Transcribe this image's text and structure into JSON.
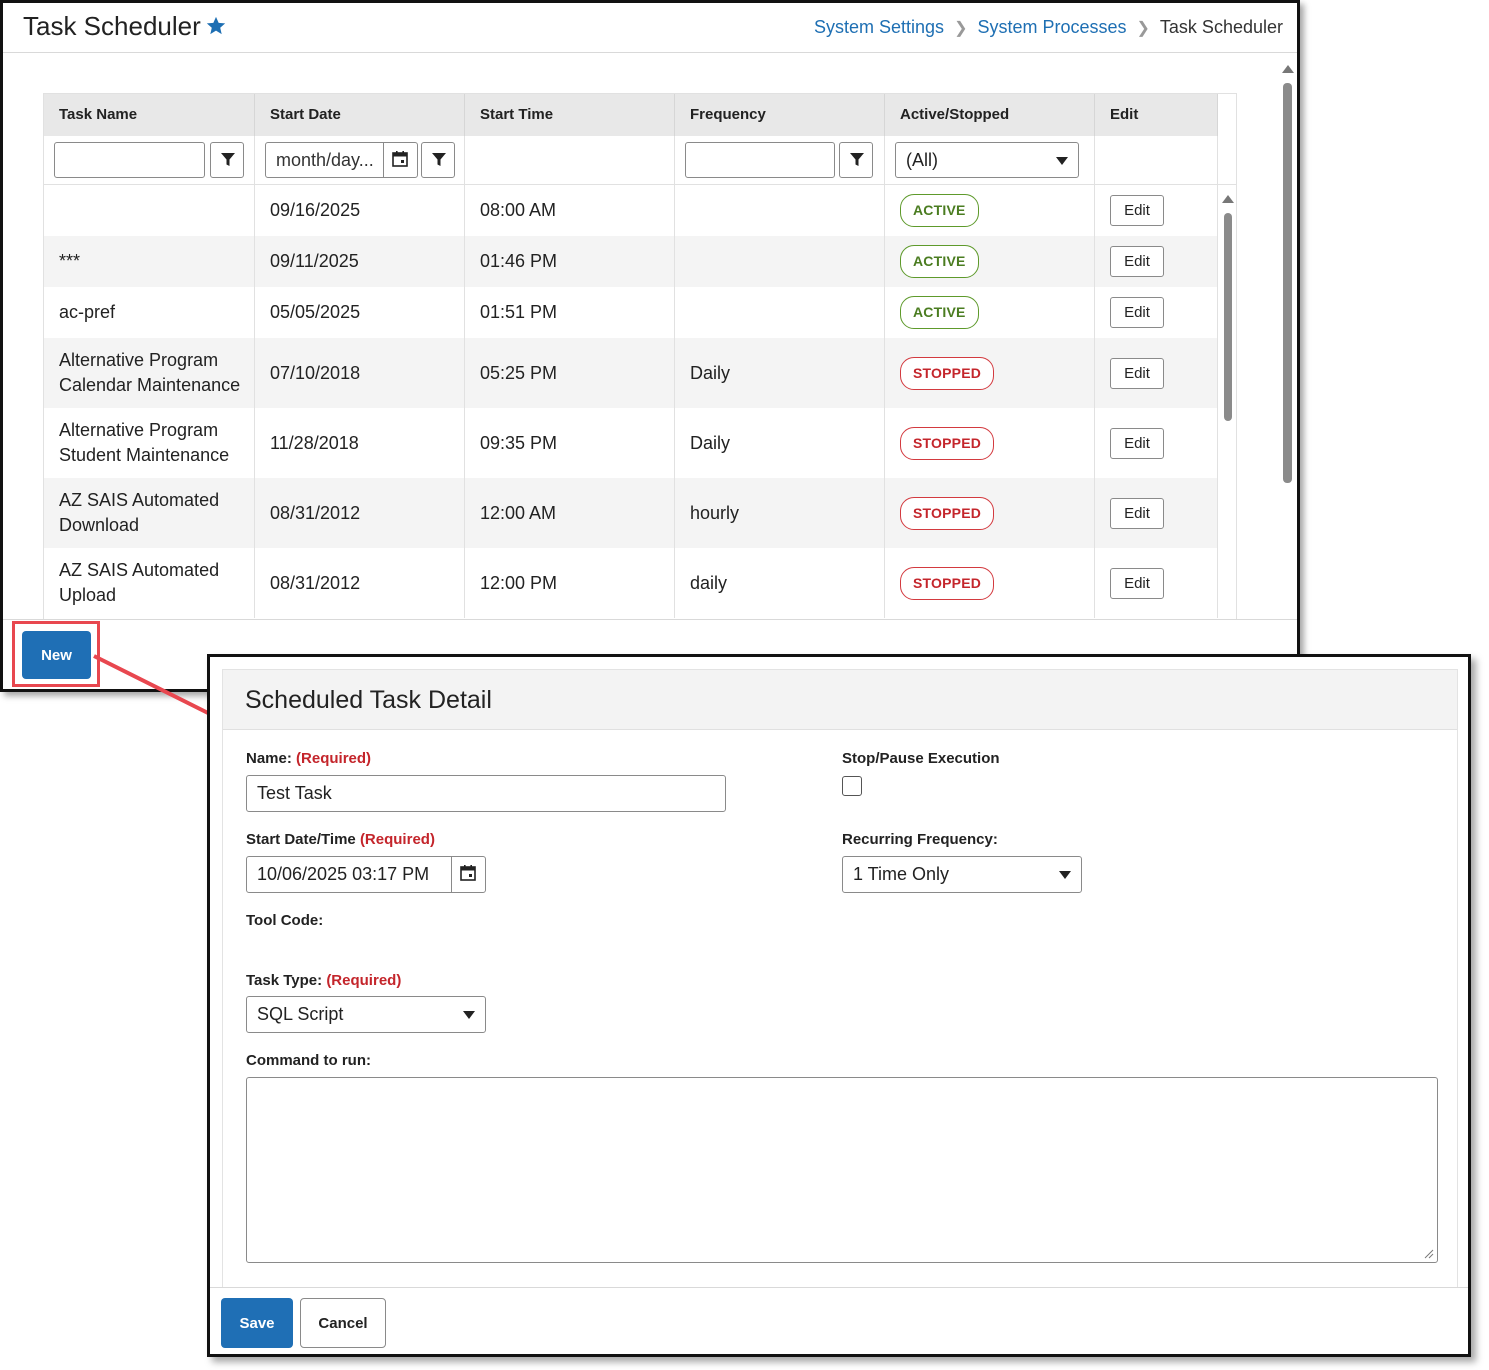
{
  "header": {
    "title": "Task Scheduler",
    "breadcrumb": [
      "System Settings",
      "System Processes",
      "Task Scheduler"
    ]
  },
  "grid": {
    "columns": [
      "Task Name",
      "Start Date",
      "Start Time",
      "Frequency",
      "Active/Stopped",
      "Edit"
    ],
    "filters": {
      "date_placeholder": "month/day...",
      "status_selected": "(All)"
    },
    "rows": [
      {
        "name": "",
        "date": "09/16/2025",
        "time": "08:00 AM",
        "frequency": "",
        "status": "ACTIVE",
        "edit": "Edit"
      },
      {
        "name": "***",
        "date": "09/11/2025",
        "time": "01:46 PM",
        "frequency": "",
        "status": "ACTIVE",
        "edit": "Edit"
      },
      {
        "name": "ac-pref",
        "date": "05/05/2025",
        "time": "01:51 PM",
        "frequency": "",
        "status": "ACTIVE",
        "edit": "Edit"
      },
      {
        "name": "Alternative Program Calendar Maintenance",
        "date": "07/10/2018",
        "time": "05:25 PM",
        "frequency": "Daily",
        "status": "STOPPED",
        "edit": "Edit"
      },
      {
        "name": "Alternative Program Student Maintenance",
        "date": "11/28/2018",
        "time": "09:35 PM",
        "frequency": "Daily",
        "status": "STOPPED",
        "edit": "Edit"
      },
      {
        "name": "AZ SAIS Automated Download",
        "date": "08/31/2012",
        "time": "12:00 AM",
        "frequency": "hourly",
        "status": "STOPPED",
        "edit": "Edit"
      },
      {
        "name": "AZ SAIS Automated Upload",
        "date": "08/31/2012",
        "time": "12:00 PM",
        "frequency": "daily",
        "status": "STOPPED",
        "edit": "Edit"
      }
    ]
  },
  "new_button": "New",
  "detail": {
    "title": "Scheduled Task Detail",
    "required_tag": "(Required)",
    "name_label": "Name:",
    "name_value": "Test Task",
    "stop_label": "Stop/Pause Execution",
    "start_label": "Start Date/Time",
    "start_value": "10/06/2025 03:17 PM",
    "recurring_label": "Recurring Frequency:",
    "recurring_value": "1 Time Only",
    "tool_code_label": "Tool Code:",
    "task_type_label": "Task Type:",
    "task_type_value": "SQL Script",
    "command_label": "Command to run:",
    "save": "Save",
    "cancel": "Cancel"
  },
  "colors": {
    "link": "#1e6fb3",
    "primary_button": "#1f6fb5",
    "active": "#4a7c20",
    "stopped": "#c4252b",
    "highlight": "#e8474f"
  },
  "icons": [
    "star-icon",
    "filter-icon",
    "calendar-icon",
    "chevron-right-icon",
    "dropdown-arrow-icon",
    "resize-handle-icon",
    "callout-arrow"
  ]
}
